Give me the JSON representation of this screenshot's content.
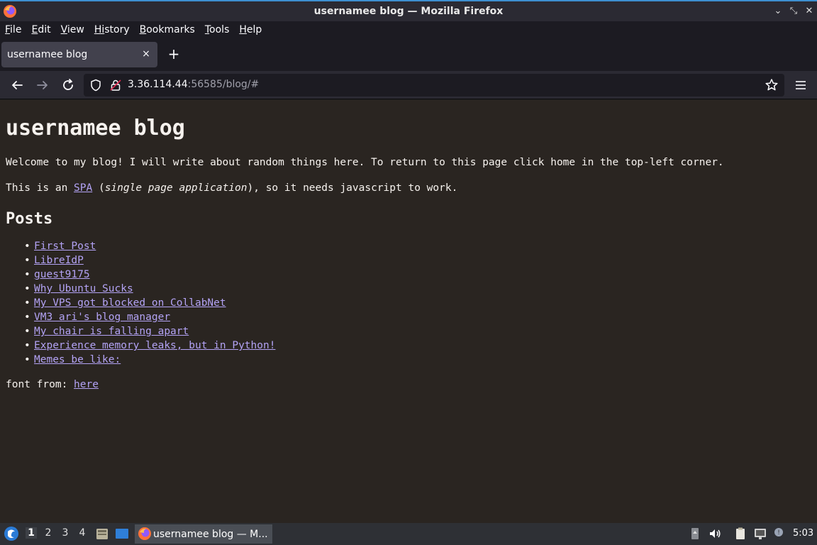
{
  "window": {
    "title": "usernamee blog — Mozilla Firefox"
  },
  "menubar": {
    "items": [
      {
        "first": "F",
        "rest": "ile"
      },
      {
        "first": "E",
        "rest": "dit"
      },
      {
        "first": "V",
        "rest": "iew"
      },
      {
        "first": "Hi",
        "rest": "story",
        "underline_index": 1
      },
      {
        "first": "B",
        "rest": "ookmarks"
      },
      {
        "first": "T",
        "rest": "ools"
      },
      {
        "first": "H",
        "rest": "elp"
      }
    ]
  },
  "tab": {
    "label": "usernamee blog",
    "close": "×"
  },
  "newtab": "+",
  "urlbar": {
    "host": "3.36.114.44",
    "rest": ":56585/blog/#"
  },
  "page": {
    "heading": "usernamee blog",
    "intro": "Welcome to my blog! I will write about random things here. To return to this page click home in the top-left corner.",
    "spa_prefix": "This is an ",
    "spa_link": "SPA",
    "spa_open": " (",
    "spa_italic": "single page application",
    "spa_suffix": "), so it needs javascript to work.",
    "posts_heading": "Posts",
    "posts": [
      "First Post",
      "LibreIdP",
      "guest9175",
      "Why Ubuntu Sucks",
      "My VPS got blocked on CollabNet",
      "VM3 ari's blog manager",
      "My chair is falling apart",
      "Experience memory leaks, but in Python!",
      "Memes be like:"
    ],
    "font_prefix": "font from: ",
    "font_link": "here"
  },
  "taskbar": {
    "workspaces": [
      "1",
      "2",
      "3",
      "4"
    ],
    "active_workspace": "1",
    "task_label": "usernamee blog — M...",
    "clock": "5:03"
  },
  "colors": {
    "link": "#b3a3f5",
    "content_bg": "#2a2521",
    "accent": "#3d8fd1"
  }
}
